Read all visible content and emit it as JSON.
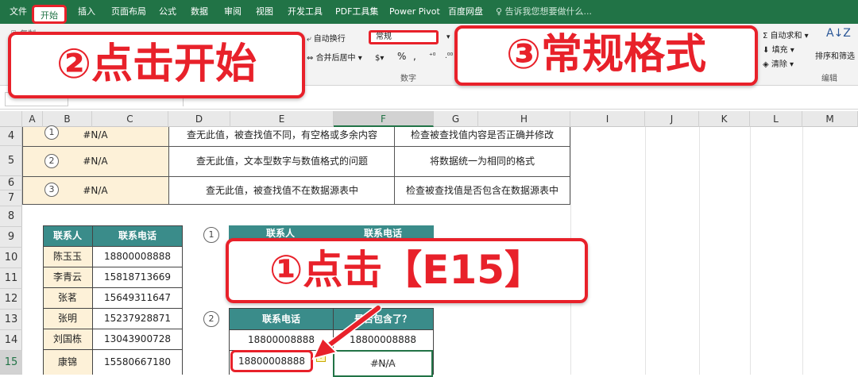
{
  "ribbon": {
    "tabs": [
      "文件",
      "开始",
      "插入",
      "页面布局",
      "公式",
      "数据",
      "审阅",
      "视图",
      "开发工具",
      "PDF工具集",
      "Power Pivot",
      "百度网盘"
    ],
    "search_placeholder": "告诉我您想要做什么...",
    "wrap_text": "自动换行",
    "merge_center": "合并后居中",
    "number_format": "常规",
    "percent": "%",
    "comma": ",",
    "number_group": "数字",
    "autosum": "自动求和",
    "fill": "填充",
    "clear": "清除",
    "sort_filter": "排序和筛选",
    "edit_group": "编辑",
    "paste_partial": "复制"
  },
  "callouts": {
    "step1": "①点击【E15】",
    "step2": "②点击开始",
    "step3": "③常规格式"
  },
  "columns": [
    "A",
    "B",
    "C",
    "D",
    "E",
    "F",
    "G",
    "H",
    "I",
    "J",
    "K",
    "L",
    "M"
  ],
  "rows": [
    "4",
    "5",
    "6",
    "7",
    "8",
    "9",
    "10",
    "11",
    "12",
    "13",
    "14",
    "15"
  ],
  "error_table": [
    {
      "num": "1",
      "code": "#N/A",
      "cause": "查无此值，被查找值不同，有空格或多余内容",
      "fix": "检查被查找值内容是否正确并修改"
    },
    {
      "num": "2",
      "code": "#N/A",
      "cause": "查无此值，文本型数字与数值格式的问题",
      "fix": "将数据统一为相同的格式"
    },
    {
      "num": "3",
      "code": "#N/A",
      "cause": "查无此值，被查找值不在数据源表中",
      "fix": "检查被查找值是否包含在数据源表中"
    }
  ],
  "contacts": {
    "headers": [
      "联系人",
      "联系电话"
    ],
    "rows": [
      [
        "陈玉玉",
        "18800008888"
      ],
      [
        "李青云",
        "15818713669"
      ],
      [
        "张茗",
        "15649311647"
      ],
      [
        "张明",
        "15237928871"
      ],
      [
        "刘国栋",
        "13043900728"
      ],
      [
        "康锦",
        "15580667180"
      ]
    ]
  },
  "lookup1": {
    "num": "1",
    "headers": [
      "联系人",
      "联系电话"
    ]
  },
  "lookup2": {
    "num": "2",
    "headers": [
      "联系电话",
      "是否包含了？"
    ],
    "rows": [
      [
        "18800008888",
        "18800008888"
      ],
      [
        "18800008888",
        "#N/A"
      ]
    ]
  },
  "colors": {
    "excel_green": "#217346",
    "header_teal": "#3a8c8a",
    "cell_peach": "#fdf1d8",
    "callout_red": "#e8212a"
  }
}
